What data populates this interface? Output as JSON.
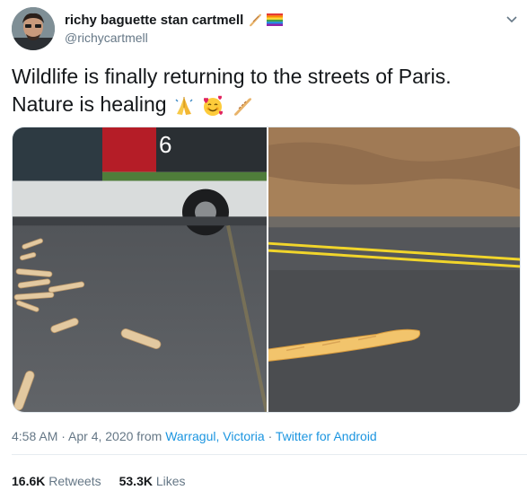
{
  "author": {
    "name": "richy baguette stan cartmell",
    "handle": "@richycartmell"
  },
  "tweet": {
    "line1": "Wildlife is finally returning to the streets of Paris.",
    "line2": "Nature is healing"
  },
  "media": {
    "left_bus_number": "6"
  },
  "meta": {
    "time": "4:58 AM · Apr 4, 2020 from ",
    "location": "Warragul, Victoria",
    "separator": " · ",
    "source": "Twitter for Android"
  },
  "stats": {
    "retweets_count": "16.6K",
    "retweets_label": "Retweets",
    "likes_count": "53.3K",
    "likes_label": "Likes"
  },
  "icons": {
    "name_emojis": [
      "baguette-icon",
      "rainbow-flag-icon"
    ],
    "text_emojis": [
      "folded-hands-icon",
      "smiling-face-with-hearts-icon",
      "baguette-icon"
    ]
  },
  "colors": {
    "link": "#1b95e0",
    "secondary_text": "#657786"
  }
}
